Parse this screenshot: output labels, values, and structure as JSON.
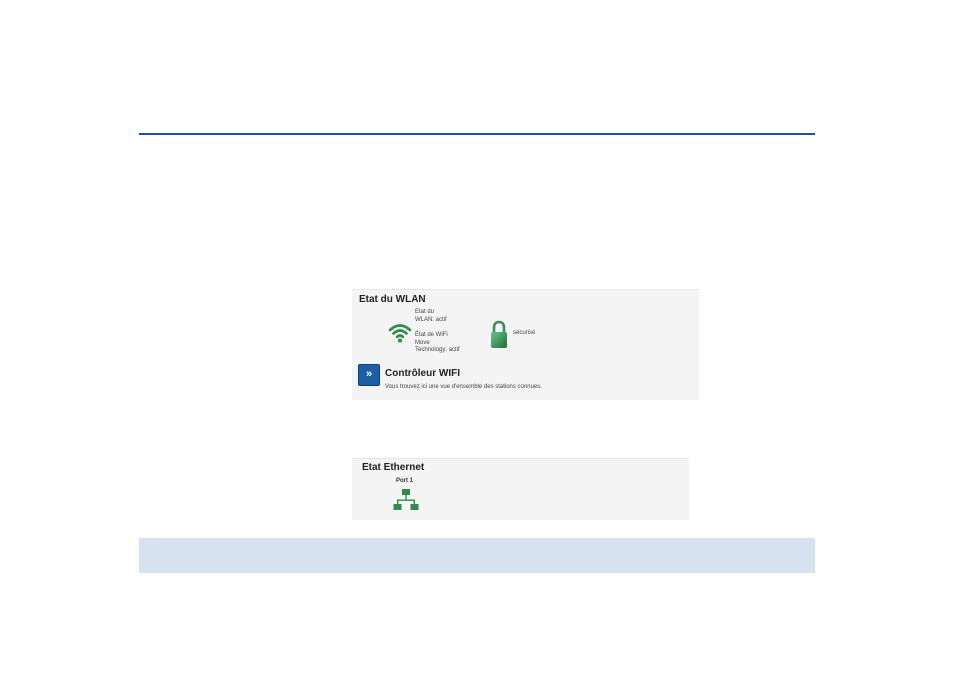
{
  "wlan": {
    "title": "Etat du WLAN",
    "status_line1": "Etat du",
    "status_line2": "WLAN: actif",
    "move_line1": "État de WiFi",
    "move_line2": "Move",
    "move_line3": "Technology: actif",
    "security_label": "sécurisé",
    "controller_title": "Contrôleur WIFI",
    "controller_desc": "Vous trouvez ici une vue d'ensemble des stations connues.",
    "icon_color": "#2f8a4e"
  },
  "ethernet": {
    "title": "Etat Ethernet",
    "port_label": "Port 1",
    "icon_color": "#2f8a4e"
  },
  "colors": {
    "rule": "#1c4fb5",
    "footer_band": "#d6e3ee",
    "button": "#1d5ea8"
  }
}
